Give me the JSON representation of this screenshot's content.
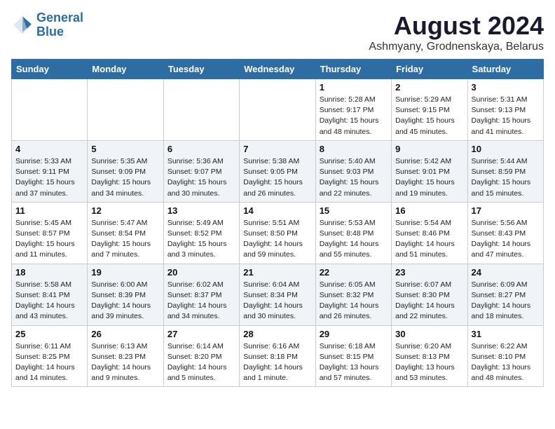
{
  "logo": {
    "line1": "General",
    "line2": "Blue"
  },
  "title": "August 2024",
  "subtitle": "Ashmyany, Grodnenskaya, Belarus",
  "days_of_week": [
    "Sunday",
    "Monday",
    "Tuesday",
    "Wednesday",
    "Thursday",
    "Friday",
    "Saturday"
  ],
  "weeks": [
    [
      {
        "day": "",
        "info": ""
      },
      {
        "day": "",
        "info": ""
      },
      {
        "day": "",
        "info": ""
      },
      {
        "day": "",
        "info": ""
      },
      {
        "day": "1",
        "info": "Sunrise: 5:28 AM\nSunset: 9:17 PM\nDaylight: 15 hours\nand 48 minutes."
      },
      {
        "day": "2",
        "info": "Sunrise: 5:29 AM\nSunset: 9:15 PM\nDaylight: 15 hours\nand 45 minutes."
      },
      {
        "day": "3",
        "info": "Sunrise: 5:31 AM\nSunset: 9:13 PM\nDaylight: 15 hours\nand 41 minutes."
      }
    ],
    [
      {
        "day": "4",
        "info": "Sunrise: 5:33 AM\nSunset: 9:11 PM\nDaylight: 15 hours\nand 37 minutes."
      },
      {
        "day": "5",
        "info": "Sunrise: 5:35 AM\nSunset: 9:09 PM\nDaylight: 15 hours\nand 34 minutes."
      },
      {
        "day": "6",
        "info": "Sunrise: 5:36 AM\nSunset: 9:07 PM\nDaylight: 15 hours\nand 30 minutes."
      },
      {
        "day": "7",
        "info": "Sunrise: 5:38 AM\nSunset: 9:05 PM\nDaylight: 15 hours\nand 26 minutes."
      },
      {
        "day": "8",
        "info": "Sunrise: 5:40 AM\nSunset: 9:03 PM\nDaylight: 15 hours\nand 22 minutes."
      },
      {
        "day": "9",
        "info": "Sunrise: 5:42 AM\nSunset: 9:01 PM\nDaylight: 15 hours\nand 19 minutes."
      },
      {
        "day": "10",
        "info": "Sunrise: 5:44 AM\nSunset: 8:59 PM\nDaylight: 15 hours\nand 15 minutes."
      }
    ],
    [
      {
        "day": "11",
        "info": "Sunrise: 5:45 AM\nSunset: 8:57 PM\nDaylight: 15 hours\nand 11 minutes."
      },
      {
        "day": "12",
        "info": "Sunrise: 5:47 AM\nSunset: 8:54 PM\nDaylight: 15 hours\nand 7 minutes."
      },
      {
        "day": "13",
        "info": "Sunrise: 5:49 AM\nSunset: 8:52 PM\nDaylight: 15 hours\nand 3 minutes."
      },
      {
        "day": "14",
        "info": "Sunrise: 5:51 AM\nSunset: 8:50 PM\nDaylight: 14 hours\nand 59 minutes."
      },
      {
        "day": "15",
        "info": "Sunrise: 5:53 AM\nSunset: 8:48 PM\nDaylight: 14 hours\nand 55 minutes."
      },
      {
        "day": "16",
        "info": "Sunrise: 5:54 AM\nSunset: 8:46 PM\nDaylight: 14 hours\nand 51 minutes."
      },
      {
        "day": "17",
        "info": "Sunrise: 5:56 AM\nSunset: 8:43 PM\nDaylight: 14 hours\nand 47 minutes."
      }
    ],
    [
      {
        "day": "18",
        "info": "Sunrise: 5:58 AM\nSunset: 8:41 PM\nDaylight: 14 hours\nand 43 minutes."
      },
      {
        "day": "19",
        "info": "Sunrise: 6:00 AM\nSunset: 8:39 PM\nDaylight: 14 hours\nand 39 minutes."
      },
      {
        "day": "20",
        "info": "Sunrise: 6:02 AM\nSunset: 8:37 PM\nDaylight: 14 hours\nand 34 minutes."
      },
      {
        "day": "21",
        "info": "Sunrise: 6:04 AM\nSunset: 8:34 PM\nDaylight: 14 hours\nand 30 minutes."
      },
      {
        "day": "22",
        "info": "Sunrise: 6:05 AM\nSunset: 8:32 PM\nDaylight: 14 hours\nand 26 minutes."
      },
      {
        "day": "23",
        "info": "Sunrise: 6:07 AM\nSunset: 8:30 PM\nDaylight: 14 hours\nand 22 minutes."
      },
      {
        "day": "24",
        "info": "Sunrise: 6:09 AM\nSunset: 8:27 PM\nDaylight: 14 hours\nand 18 minutes."
      }
    ],
    [
      {
        "day": "25",
        "info": "Sunrise: 6:11 AM\nSunset: 8:25 PM\nDaylight: 14 hours\nand 14 minutes."
      },
      {
        "day": "26",
        "info": "Sunrise: 6:13 AM\nSunset: 8:23 PM\nDaylight: 14 hours\nand 9 minutes."
      },
      {
        "day": "27",
        "info": "Sunrise: 6:14 AM\nSunset: 8:20 PM\nDaylight: 14 hours\nand 5 minutes."
      },
      {
        "day": "28",
        "info": "Sunrise: 6:16 AM\nSunset: 8:18 PM\nDaylight: 14 hours\nand 1 minute."
      },
      {
        "day": "29",
        "info": "Sunrise: 6:18 AM\nSunset: 8:15 PM\nDaylight: 13 hours\nand 57 minutes."
      },
      {
        "day": "30",
        "info": "Sunrise: 6:20 AM\nSunset: 8:13 PM\nDaylight: 13 hours\nand 53 minutes."
      },
      {
        "day": "31",
        "info": "Sunrise: 6:22 AM\nSunset: 8:10 PM\nDaylight: 13 hours\nand 48 minutes."
      }
    ]
  ]
}
